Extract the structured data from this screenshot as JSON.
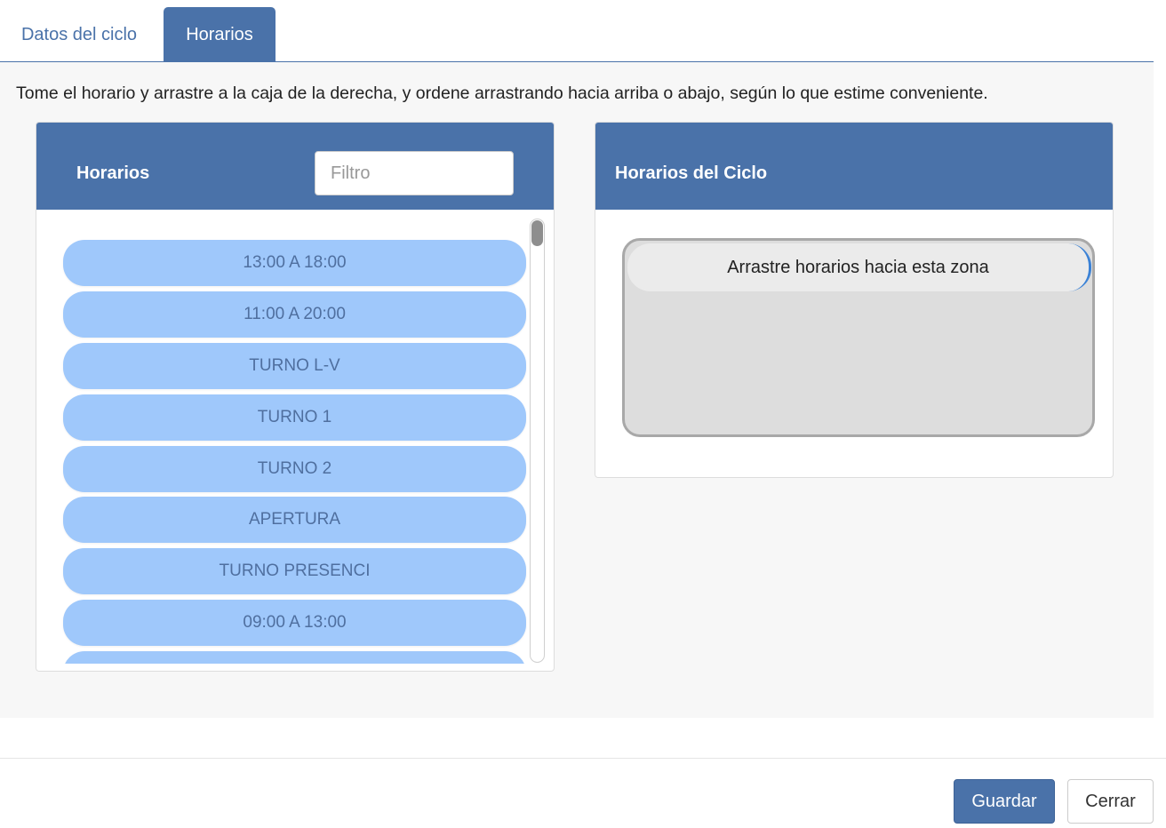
{
  "tabs": [
    {
      "label": "Datos del ciclo",
      "active": false
    },
    {
      "label": "Horarios",
      "active": true
    }
  ],
  "instructions": "Tome el horario y arrastre a la caja de la derecha, y ordene arrastrando hacia arriba o abajo, según lo que estime conveniente.",
  "left_panel": {
    "title": "Horarios",
    "filter_placeholder": "Filtro",
    "items": [
      "13:00 A 18:00",
      "11:00 A 20:00",
      "TURNO L-V",
      "TURNO 1",
      "TURNO 2",
      "APERTURA",
      "TURNO PRESENCI",
      "09:00 A 13:00",
      ""
    ]
  },
  "right_panel": {
    "title": "Horarios del Ciclo",
    "drop_placeholder": "Arrastre horarios hacia esta zona"
  },
  "footer": {
    "save_label": "Guardar",
    "close_label": "Cerrar"
  },
  "colors": {
    "primary": "#4a72a9",
    "item_bg": "#9fc8fb",
    "item_text": "#4f6f9f",
    "drop_zone_bg": "#dddddd",
    "drop_accent": "#3b82d6"
  }
}
